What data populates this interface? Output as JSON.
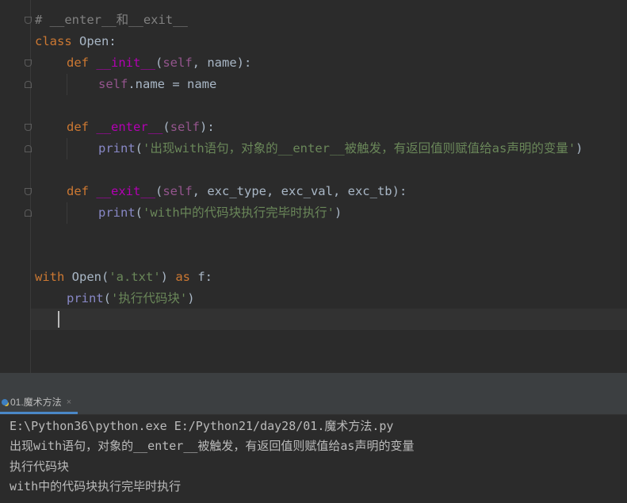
{
  "editor": {
    "lines": [
      {
        "type": "comment",
        "text": "# __enter__和__exit__"
      },
      {
        "type": "class",
        "kw": "class",
        "name": "Open",
        "colon": ":"
      },
      {
        "type": "def",
        "kw": "def",
        "name": "__init__",
        "open": "(",
        "self": "self",
        "rest": ", name):"
      },
      {
        "type": "assign",
        "self": "self",
        "rest": ".name = name"
      },
      {
        "type": "blank"
      },
      {
        "type": "def",
        "kw": "def",
        "name": "__enter__",
        "open": "(",
        "self": "self",
        "rest": "):"
      },
      {
        "type": "print",
        "fn": "print",
        "open": "(",
        "str": "'出现with语句，对象的__enter__被触发，有返回值则赋值给as声明的变量'",
        "close": ")"
      },
      {
        "type": "blank"
      },
      {
        "type": "def",
        "kw": "def",
        "name": "__exit__",
        "open": "(",
        "self": "self",
        "rest": ", exc_type, exc_val, exc_tb):"
      },
      {
        "type": "print",
        "fn": "print",
        "open": "(",
        "str": "'with中的代码块执行完毕时执行'",
        "close": ")"
      },
      {
        "type": "blank"
      },
      {
        "type": "blank"
      },
      {
        "type": "with",
        "kw": "with",
        "mid": " Open(",
        "str": "'a.txt'",
        "close": ") ",
        "kw2": "as",
        "rest": " f:"
      },
      {
        "type": "print2",
        "fn": "print",
        "open": "(",
        "str": "'执行代码块'",
        "close": ")"
      },
      {
        "type": "blank"
      }
    ]
  },
  "run_panel": {
    "tab_label": "01.魔术方法",
    "close_glyph": "×",
    "output": [
      "E:\\Python36\\python.exe E:/Python21/day28/01.魔术方法.py",
      "出现with语句，对象的__enter__被触发，有返回值则赋值给as声明的变量",
      "执行代码块",
      "with中的代码块执行完毕时执行"
    ]
  },
  "colors": {
    "background": "#2b2b2b",
    "keyword": "#cc7832",
    "self": "#94558d",
    "dunder": "#b200b2",
    "string": "#6a8759",
    "comment": "#808080",
    "builtin": "#8888c6",
    "text": "#a9b7c6",
    "tab_accent": "#4a88c7"
  }
}
